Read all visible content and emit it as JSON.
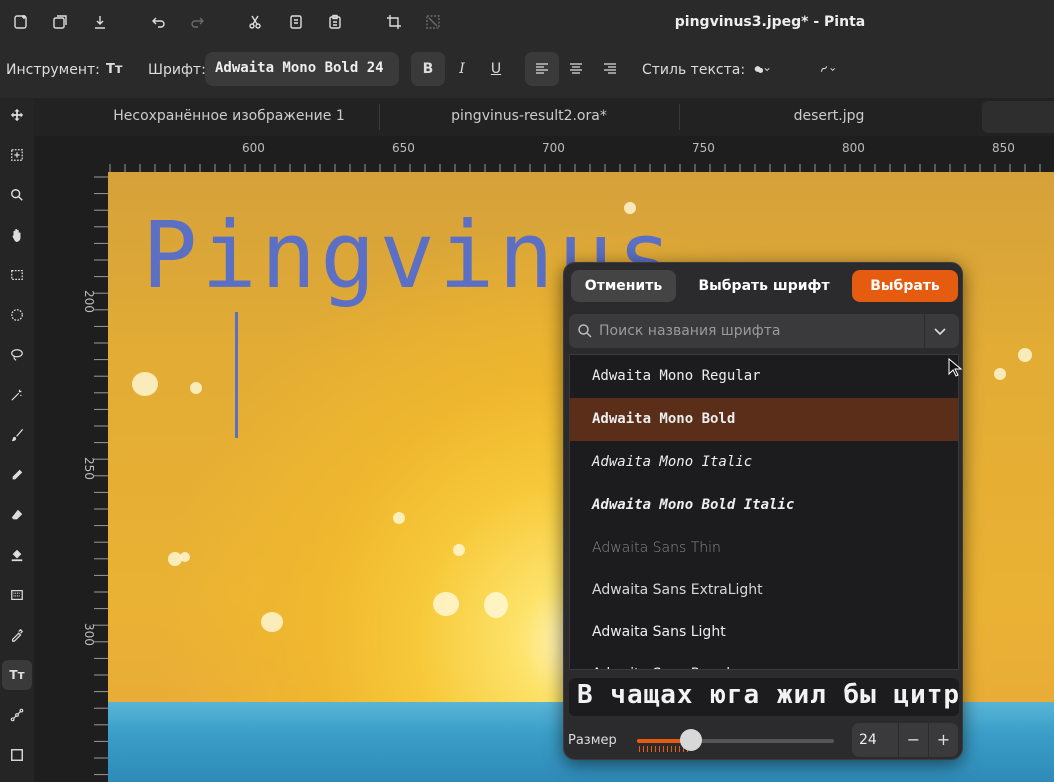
{
  "window": {
    "title": "pingvinus3.jpeg* - Pinta"
  },
  "toolbar": {
    "tool_label": "Инструмент:",
    "tool_icon_text": "Tт",
    "font_label": "Шрифт:",
    "font_value": "Adwaita Mono Bold 24",
    "bold": "B",
    "italic": "I",
    "underline": "U",
    "style_label": "Стиль текста:"
  },
  "tabs": [
    {
      "label": "Несохранённое изображение 1"
    },
    {
      "label": "pingvinus-result2.ora*"
    },
    {
      "label": "desert.jpg"
    }
  ],
  "rulers": {
    "horizontal": [
      "600",
      "650",
      "700",
      "750",
      "800",
      "850"
    ],
    "vertical": [
      "200",
      "250",
      "300"
    ]
  },
  "canvas": {
    "text": "Pingvinus"
  },
  "font_dialog": {
    "cancel": "Отменить",
    "title": "Выбрать шрифт",
    "select": "Выбрать",
    "search_placeholder": "Поиск названия шрифта",
    "fonts": [
      {
        "name": "Adwaita Mono Regular"
      },
      {
        "name": "Adwaita Mono Bold"
      },
      {
        "name": "Adwaita Mono Italic"
      },
      {
        "name": "Adwaita Mono Bold Italic"
      },
      {
        "name": "Adwaita Sans Thin"
      },
      {
        "name": "Adwaita Sans ExtraLight"
      },
      {
        "name": "Adwaita Sans Light"
      },
      {
        "name": "Adwaita Sans Regular"
      }
    ],
    "selected_font": "Adwaita Mono Bold",
    "preview_text": "В чащах юга жил бы цитрус",
    "size_label": "Размер",
    "size_value": "24",
    "minus": "−",
    "plus": "+"
  },
  "colors": {
    "accent": "#e55c10",
    "selected_row": "#5a2e18",
    "canvas_text": "#5b6fc4"
  }
}
